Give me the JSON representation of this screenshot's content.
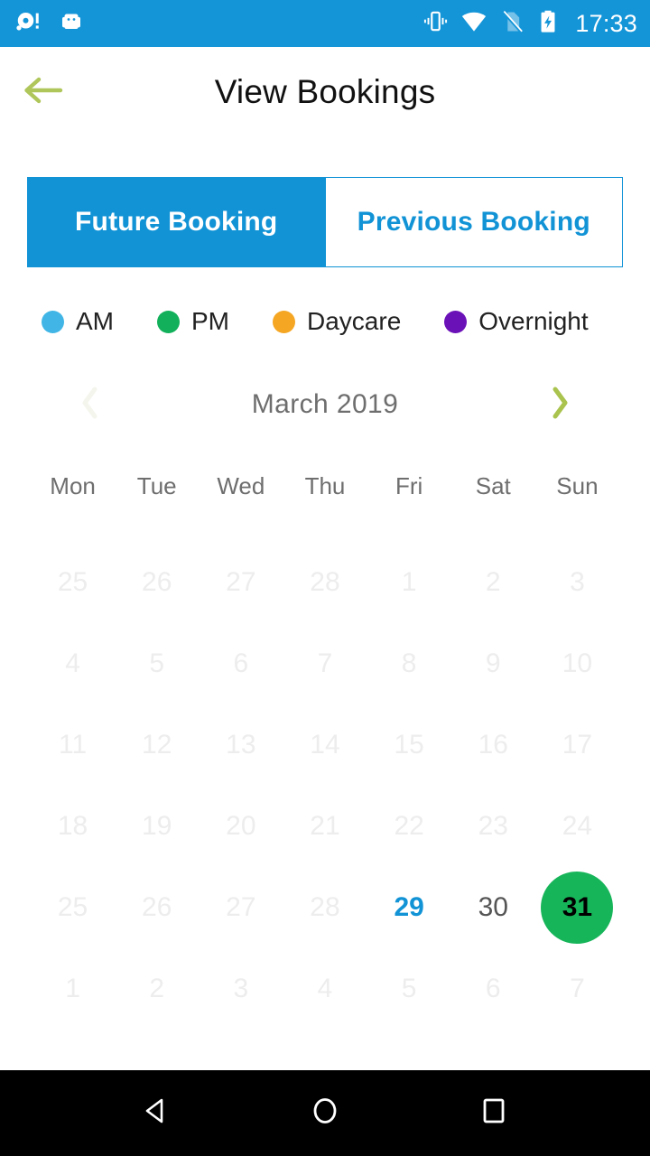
{
  "status_bar": {
    "background": "#1495D8",
    "time": "17:33",
    "left_icons": [
      "notification-dot-alert-icon",
      "android-robot-icon"
    ],
    "right_icons": [
      "vibrate-icon",
      "wifi-icon",
      "no-sim-icon",
      "battery-charging-icon"
    ]
  },
  "header": {
    "title": "View Bookings",
    "back_icon": "back-arrow-icon",
    "back_icon_color": "#AFC65A"
  },
  "tabs": [
    {
      "label": "Future Booking",
      "active": true
    },
    {
      "label": "Previous Booking",
      "active": false
    }
  ],
  "tab_colors": {
    "active_bg": "#1193D6",
    "active_text": "#FFFFFF",
    "inactive_bg": "#FFFFFF",
    "inactive_text": "#1193D6",
    "border": "#1193D6"
  },
  "legend": [
    {
      "label": "AM",
      "color": "#41B6E6"
    },
    {
      "label": "PM",
      "color": "#12B05A"
    },
    {
      "label": "Daycare",
      "color": "#F5A623"
    },
    {
      "label": "Overnight",
      "color": "#6B11B8"
    }
  ],
  "month_nav": {
    "label": "March 2019",
    "prev_icon": "chevron-left-icon",
    "next_icon": "chevron-right-icon",
    "prev_disabled": true,
    "prev_color": "#F4F5EC",
    "next_color": "#A9C34E"
  },
  "calendar": {
    "weekday_headers": [
      "Mon",
      "Tue",
      "Wed",
      "Thu",
      "Fri",
      "Sat",
      "Sun"
    ],
    "weeks": [
      [
        {
          "day": "25",
          "state": "muted"
        },
        {
          "day": "26",
          "state": "muted"
        },
        {
          "day": "27",
          "state": "muted"
        },
        {
          "day": "28",
          "state": "muted"
        },
        {
          "day": "1",
          "state": "muted"
        },
        {
          "day": "2",
          "state": "muted"
        },
        {
          "day": "3",
          "state": "muted"
        }
      ],
      [
        {
          "day": "4",
          "state": "muted"
        },
        {
          "day": "5",
          "state": "muted"
        },
        {
          "day": "6",
          "state": "muted"
        },
        {
          "day": "7",
          "state": "muted"
        },
        {
          "day": "8",
          "state": "muted"
        },
        {
          "day": "9",
          "state": "muted"
        },
        {
          "day": "10",
          "state": "muted"
        }
      ],
      [
        {
          "day": "11",
          "state": "muted"
        },
        {
          "day": "12",
          "state": "muted"
        },
        {
          "day": "13",
          "state": "muted"
        },
        {
          "day": "14",
          "state": "muted"
        },
        {
          "day": "15",
          "state": "muted"
        },
        {
          "day": "16",
          "state": "muted"
        },
        {
          "day": "17",
          "state": "muted"
        }
      ],
      [
        {
          "day": "18",
          "state": "muted"
        },
        {
          "day": "19",
          "state": "muted"
        },
        {
          "day": "20",
          "state": "muted"
        },
        {
          "day": "21",
          "state": "muted"
        },
        {
          "day": "22",
          "state": "muted"
        },
        {
          "day": "23",
          "state": "muted"
        },
        {
          "day": "24",
          "state": "muted"
        }
      ],
      [
        {
          "day": "25",
          "state": "muted"
        },
        {
          "day": "26",
          "state": "muted"
        },
        {
          "day": "27",
          "state": "muted"
        },
        {
          "day": "28",
          "state": "muted"
        },
        {
          "day": "29",
          "state": "today"
        },
        {
          "day": "30",
          "state": "normal"
        },
        {
          "day": "31",
          "state": "booked",
          "booking_color": "#17B55A"
        }
      ],
      [
        {
          "day": "1",
          "state": "muted"
        },
        {
          "day": "2",
          "state": "muted"
        },
        {
          "day": "3",
          "state": "muted"
        },
        {
          "day": "4",
          "state": "muted"
        },
        {
          "day": "5",
          "state": "muted"
        },
        {
          "day": "6",
          "state": "muted"
        },
        {
          "day": "7",
          "state": "muted"
        }
      ]
    ]
  },
  "nav_bar": {
    "background": "#000000",
    "buttons": [
      "back-triangle-icon",
      "home-circle-icon",
      "recents-square-icon"
    ]
  }
}
